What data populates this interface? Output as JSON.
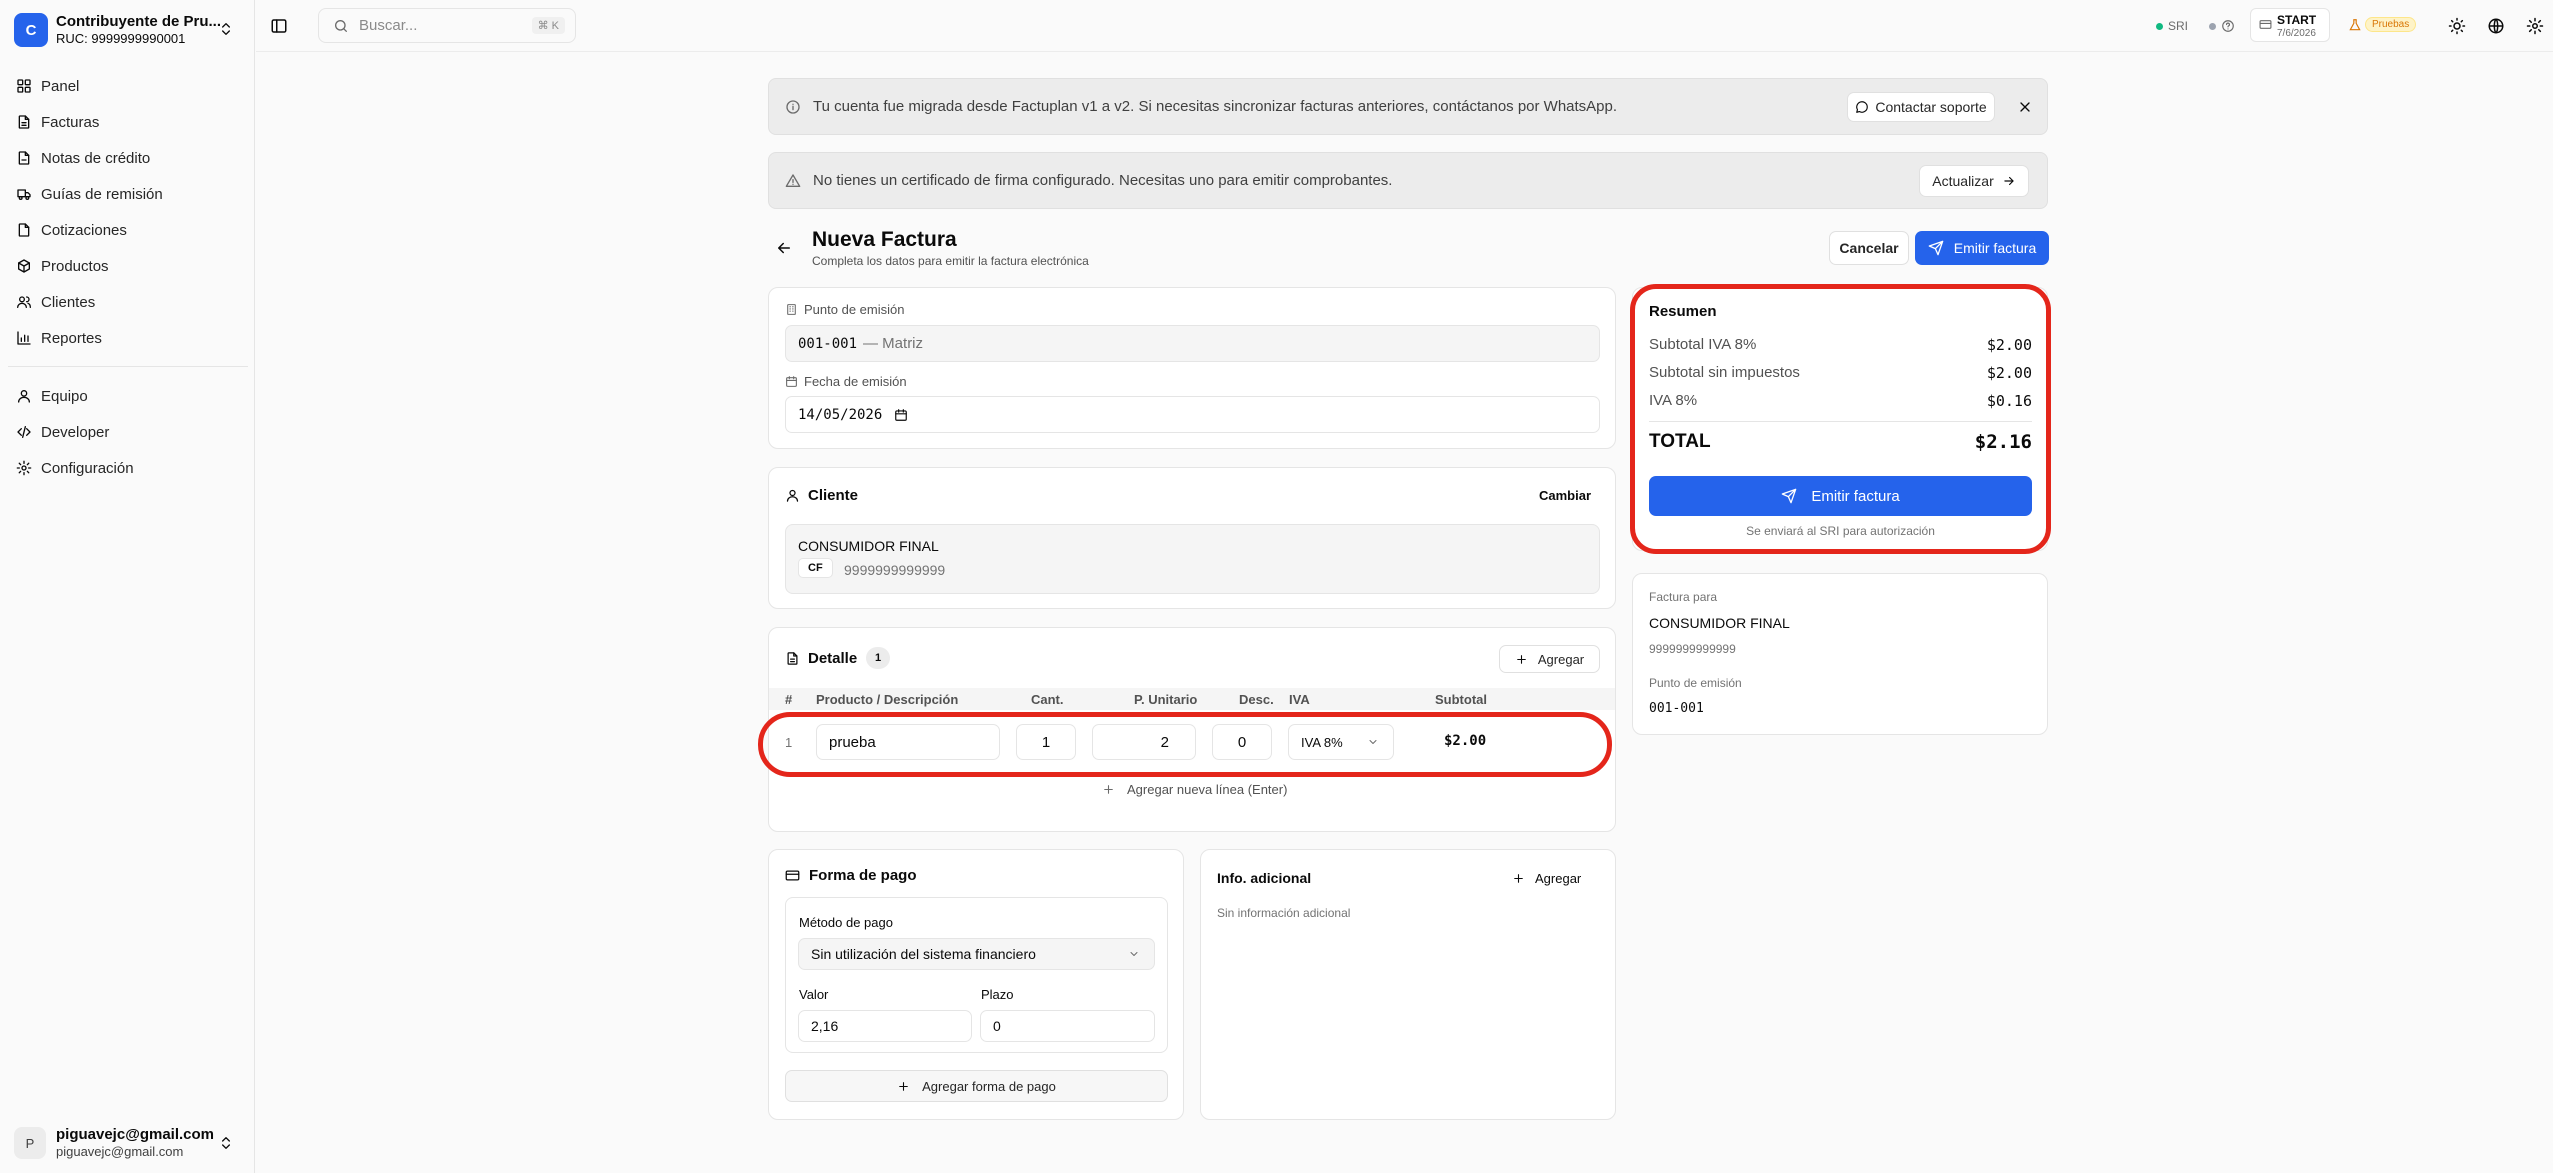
{
  "org": {
    "initial": "C",
    "name": "Contribuyente de Pru...",
    "ruc": "RUC: 9999999990001"
  },
  "nav": {
    "main": [
      "Panel",
      "Facturas",
      "Notas de crédito",
      "Guías de remisión",
      "Cotizaciones",
      "Productos",
      "Clientes",
      "Reportes"
    ],
    "secondary": [
      "Equipo",
      "Developer",
      "Configuración"
    ]
  },
  "user": {
    "initial": "P",
    "name": "piguavejc@gmail.com",
    "email": "piguavejc@gmail.com"
  },
  "topbar": {
    "search_placeholder": "Buscar...",
    "shortcut": "⌘ K",
    "sri_label": "SRI",
    "plan_name": "START",
    "plan_date": "7/6/2026",
    "env_badge": "Pruebas",
    "status_colors": {
      "sri": "#10b981",
      "other": "#9ca3af"
    }
  },
  "banners": {
    "migration": "Tu cuenta fue migrada desde Factuplan v1 a v2. Si necesitas sincronizar facturas anteriores, contáctanos por WhatsApp.",
    "migration_button": "Contactar soporte",
    "certificate": "No tienes un certificado de firma configurado. Necesitas uno para emitir comprobantes.",
    "certificate_button": "Actualizar"
  },
  "header": {
    "title": "Nueva Factura",
    "subtitle": "Completa los datos para emitir la factura electrónica",
    "cancel": "Cancelar",
    "emit": "Emitir factura"
  },
  "emission": {
    "point_label": "Punto de emisión",
    "point_code": "001-001",
    "point_name": "— Matriz",
    "date_label": "Fecha de emisión",
    "date_value": "14/05/2026"
  },
  "client": {
    "title": "Cliente",
    "change": "Cambiar",
    "name": "CONSUMIDOR FINAL",
    "badge": "CF",
    "id": "9999999999999"
  },
  "detail": {
    "title": "Detalle",
    "count": "1",
    "add": "Agregar",
    "columns": [
      "#",
      "Producto / Descripción",
      "Cant.",
      "P. Unitario",
      "Desc.",
      "IVA",
      "Subtotal"
    ],
    "rows": [
      {
        "num": "1",
        "product": "prueba",
        "qty": "1",
        "price": "2",
        "discount": "0",
        "iva": "IVA 8%",
        "subtotal": "$2.00"
      }
    ],
    "add_line": "Agregar nueva línea (Enter)"
  },
  "payment": {
    "title": "Forma de pago",
    "method_label": "Método de pago",
    "method_value": "Sin utilización del sistema financiero",
    "value_label": "Valor",
    "value": "2,16",
    "term_label": "Plazo",
    "term": "0",
    "add": "Agregar forma de pago"
  },
  "extra_info": {
    "title": "Info. adicional",
    "add": "Agregar",
    "empty": "Sin información adicional"
  },
  "summary": {
    "title": "Resumen",
    "rows": [
      {
        "label": "Subtotal IVA 8%",
        "value": "$2.00"
      },
      {
        "label": "Subtotal sin impuestos",
        "value": "$2.00"
      },
      {
        "label": "IVA 8%",
        "value": "$0.16"
      }
    ],
    "total_label": "TOTAL",
    "total_value": "$2.16",
    "emit": "Emitir factura",
    "note": "Se enviará al SRI para autorización"
  },
  "invoice_for": {
    "label": "Factura para",
    "name": "CONSUMIDOR FINAL",
    "id": "9999999999999",
    "point_label": "Punto de emisión",
    "point": "001-001"
  },
  "colors": {
    "primary": "#2563eb",
    "highlight": "#e4261b",
    "warning": "#d97706"
  }
}
